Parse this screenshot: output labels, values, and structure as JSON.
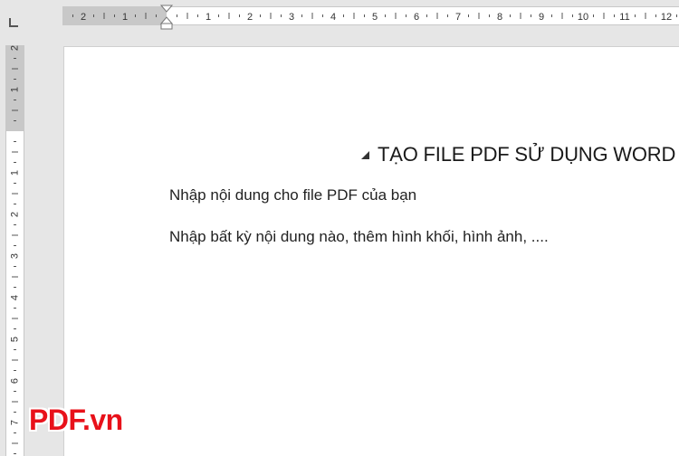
{
  "ruler": {
    "horizontal_labels": [
      "2",
      "1",
      "1",
      "2",
      "3",
      "4",
      "5",
      "6",
      "7",
      "8",
      "9",
      "10",
      "11",
      "12"
    ],
    "vertical_labels": [
      "2",
      "1",
      "1",
      "2",
      "3",
      "4",
      "5",
      "6",
      "7"
    ]
  },
  "document": {
    "heading": "TẠO FILE PDF SỬ DỤNG WORD",
    "paragraphs": [
      "Nhập nội dung cho file PDF của bạn",
      "Nhập bất kỳ nội dung nào, thêm hình khối, hình ảnh, ...."
    ]
  },
  "watermark": {
    "text": "PDF.vn",
    "color": "#e8111a"
  }
}
